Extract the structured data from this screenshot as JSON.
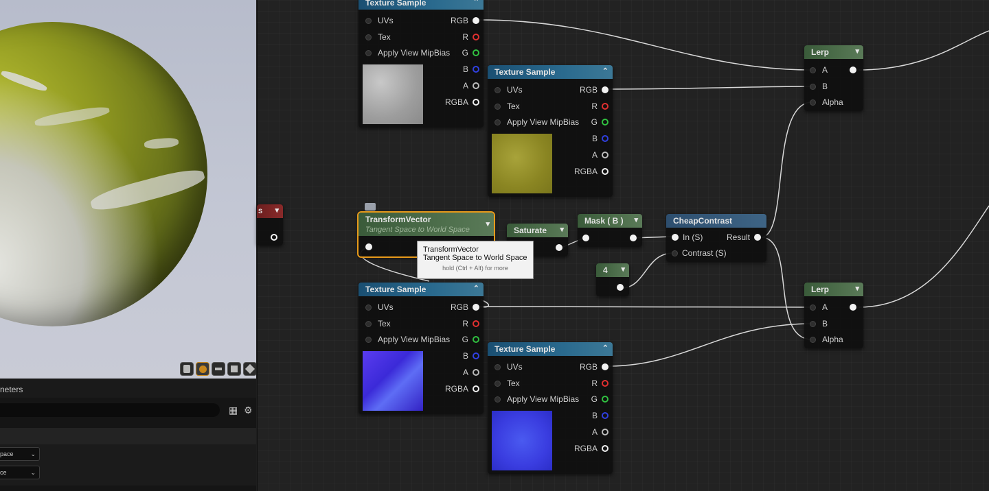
{
  "viewport": {
    "toolbar_icons": [
      "cylinder-icon",
      "sphere-icon",
      "plane-icon",
      "cube-icon",
      "custom-mesh-icon"
    ]
  },
  "params_panel": {
    "title": "neters",
    "select1": "pace",
    "select2": "ce"
  },
  "nodes": {
    "tex1": {
      "title": "Texture Sample",
      "inputs": [
        "UVs",
        "Tex",
        "Apply View MipBias"
      ],
      "outputs": [
        "RGB",
        "R",
        "G",
        "B",
        "A",
        "RGBA"
      ]
    },
    "tex2": {
      "title": "Texture Sample",
      "inputs": [
        "UVs",
        "Tex",
        "Apply View MipBias"
      ],
      "outputs": [
        "RGB",
        "R",
        "G",
        "B",
        "A",
        "RGBA"
      ]
    },
    "tex3": {
      "title": "Texture Sample",
      "inputs": [
        "UVs",
        "Tex",
        "Apply View MipBias"
      ],
      "outputs": [
        "RGB",
        "R",
        "G",
        "B",
        "A",
        "RGBA"
      ]
    },
    "tex4": {
      "title": "Texture Sample",
      "inputs": [
        "UVs",
        "Tex",
        "Apply View MipBias"
      ],
      "outputs": [
        "RGB",
        "R",
        "G",
        "B",
        "A",
        "RGBA"
      ]
    },
    "transform": {
      "title": "TransformVector",
      "subtitle": "Tangent Space to World Space"
    },
    "saturate": {
      "title": "Saturate"
    },
    "mask": {
      "title": "Mask ( B )"
    },
    "constant": {
      "title": "4"
    },
    "contrast": {
      "title": "CheapContrast",
      "inputs": [
        "In (S)",
        "Contrast (S)"
      ],
      "output": "Result"
    },
    "lerp1": {
      "title": "Lerp",
      "pins": [
        "A",
        "B",
        "Alpha"
      ]
    },
    "lerp2": {
      "title": "Lerp",
      "pins": [
        "A",
        "B",
        "Alpha"
      ]
    },
    "partial": {
      "title": "S"
    }
  },
  "tooltip": {
    "line1": "TransformVector",
    "line2": "Tangent Space to World Space",
    "hint": "hold (Ctrl + Alt) for more"
  },
  "colors": {
    "pin_r": "#e03030",
    "pin_g": "#30c040",
    "pin_b": "#3040e0",
    "pin_a": "#bbbbbb",
    "selection": "#e89a1a"
  }
}
